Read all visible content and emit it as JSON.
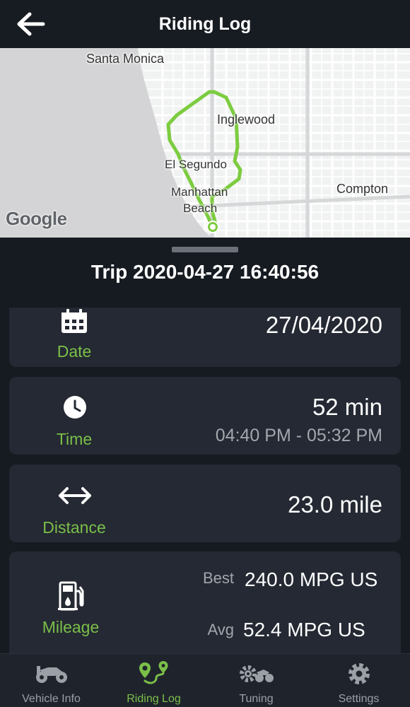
{
  "header": {
    "title": "Riding Log",
    "back_icon": "arrow-left-icon"
  },
  "map": {
    "labels": {
      "santa_monica": "Santa Monica",
      "inglewood": "Inglewood",
      "el_segundo": "El Segundo",
      "manhattan": "Manhattan",
      "beach": "Beach",
      "compton": "Compton"
    },
    "attribution": "Google",
    "route_color": "#7ccc3f"
  },
  "trip": {
    "title": "Trip 2020-04-27 16:40:56"
  },
  "cards": {
    "date": {
      "label": "Date",
      "icon": "calendar-icon",
      "value": "27/04/2020"
    },
    "time": {
      "label": "Time",
      "icon": "clock-icon",
      "value": "52 min",
      "range": "04:40 PM - 05:32 PM"
    },
    "distance": {
      "label": "Distance",
      "icon": "double-arrow-icon",
      "value": "23.0 mile"
    },
    "mileage": {
      "label": "Mileage",
      "icon": "fuel-pump-icon",
      "best_label": "Best",
      "best_value": "240.0 MPG US",
      "avg_label": "Avg",
      "avg_value": "52.4 MPG US"
    }
  },
  "tabs": [
    {
      "label": "Vehicle Info",
      "icon": "motorcycle-icon",
      "active": false
    },
    {
      "label": "Riding Log",
      "icon": "route-icon",
      "active": true
    },
    {
      "label": "Tuning",
      "icon": "tuning-icon",
      "active": false
    },
    {
      "label": "Settings",
      "icon": "gear-icon",
      "active": false
    }
  ],
  "colors": {
    "accent": "#7bbf48",
    "background": "#161a21",
    "card": "#242933"
  }
}
